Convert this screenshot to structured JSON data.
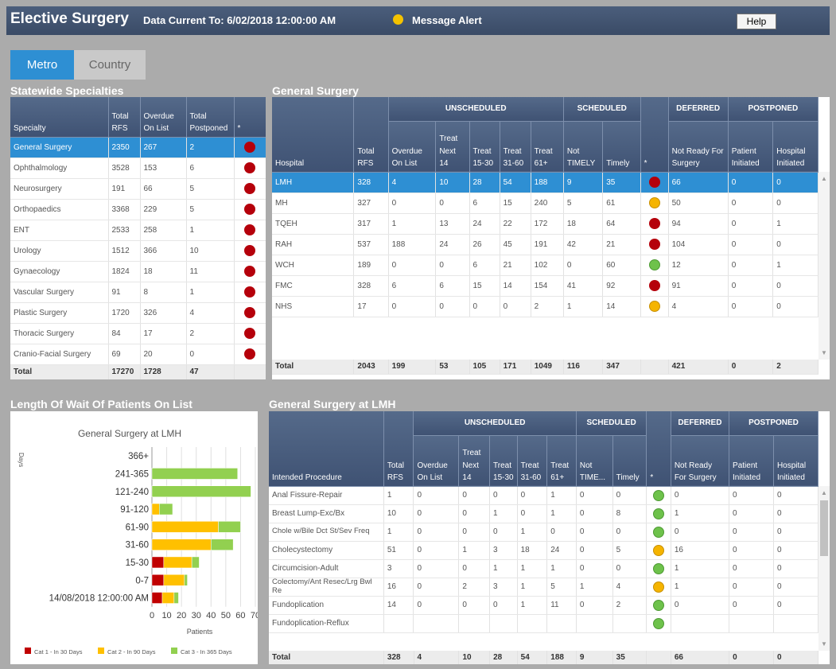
{
  "header": {
    "title": "Elective Surgery",
    "data_current": "Data Current To: 6/02/2018 12:00:00 AM",
    "message_alert": "Message Alert",
    "help": "Help"
  },
  "tabs": [
    {
      "label": "Metro",
      "active": true
    },
    {
      "label": "Country",
      "active": false
    }
  ],
  "statewide": {
    "title": "Statewide Specialties",
    "headers": [
      "Specialty",
      "Total RFS",
      "Overdue On List",
      "Total Postponed",
      "*"
    ],
    "rows": [
      {
        "specialty": "General Surgery",
        "rfs": "2350",
        "overdue": "267",
        "postponed": "2",
        "status": "red",
        "selected": true
      },
      {
        "specialty": "Ophthalmology",
        "rfs": "3528",
        "overdue": "153",
        "postponed": "6",
        "status": "red"
      },
      {
        "specialty": "Neurosurgery",
        "rfs": "191",
        "overdue": "66",
        "postponed": "5",
        "status": "red"
      },
      {
        "specialty": "Orthopaedics",
        "rfs": "3368",
        "overdue": "229",
        "postponed": "5",
        "status": "red"
      },
      {
        "specialty": "ENT",
        "rfs": "2533",
        "overdue": "258",
        "postponed": "1",
        "status": "red"
      },
      {
        "specialty": "Urology",
        "rfs": "1512",
        "overdue": "366",
        "postponed": "10",
        "status": "red"
      },
      {
        "specialty": "Gynaecology",
        "rfs": "1824",
        "overdue": "18",
        "postponed": "11",
        "status": "red"
      },
      {
        "specialty": "Vascular Surgery",
        "rfs": "91",
        "overdue": "8",
        "postponed": "1",
        "status": "red"
      },
      {
        "specialty": "Plastic Surgery",
        "rfs": "1720",
        "overdue": "326",
        "postponed": "4",
        "status": "red"
      },
      {
        "specialty": "Thoracic Surgery",
        "rfs": "84",
        "overdue": "17",
        "postponed": "2",
        "status": "red"
      },
      {
        "specialty": "Cranio-Facial Surgery",
        "rfs": "69",
        "overdue": "20",
        "postponed": "0",
        "status": "red"
      }
    ],
    "total": {
      "label": "Total",
      "rfs": "17270",
      "overdue": "1728",
      "postponed": "47"
    }
  },
  "general_surgery": {
    "title": "General Surgery",
    "groups": [
      "UNSCHEDULED",
      "SCHEDULED",
      "DEFERRED",
      "POSTPONED"
    ],
    "headers": [
      "Hospital",
      "Total RFS",
      "Overdue On List",
      "Treat Next 14",
      "Treat 15-30",
      "Treat 31-60",
      "Treat 61+",
      "Not TIMELY",
      "Timely",
      "*",
      "Not Ready For Surgery",
      "Patient Initiated",
      "Hospital Initiated"
    ],
    "rows": [
      {
        "cells": [
          "LMH",
          "328",
          "4",
          "10",
          "28",
          "54",
          "188",
          "9",
          "35"
        ],
        "status": "red",
        "tail": [
          "66",
          "0",
          "0"
        ],
        "selected": true
      },
      {
        "cells": [
          "MH",
          "327",
          "0",
          "0",
          "6",
          "15",
          "240",
          "5",
          "61"
        ],
        "status": "amber",
        "tail": [
          "50",
          "0",
          "0"
        ]
      },
      {
        "cells": [
          "TQEH",
          "317",
          "1",
          "13",
          "24",
          "22",
          "172",
          "18",
          "64"
        ],
        "status": "red",
        "tail": [
          "94",
          "0",
          "1"
        ]
      },
      {
        "cells": [
          "RAH",
          "537",
          "188",
          "24",
          "26",
          "45",
          "191",
          "42",
          "21"
        ],
        "status": "red",
        "tail": [
          "104",
          "0",
          "0"
        ]
      },
      {
        "cells": [
          "WCH",
          "189",
          "0",
          "0",
          "6",
          "21",
          "102",
          "0",
          "60"
        ],
        "status": "green",
        "tail": [
          "12",
          "0",
          "1"
        ]
      },
      {
        "cells": [
          "FMC",
          "328",
          "6",
          "6",
          "15",
          "14",
          "154",
          "41",
          "92"
        ],
        "status": "red",
        "tail": [
          "91",
          "0",
          "0"
        ]
      },
      {
        "cells": [
          "NHS",
          "17",
          "0",
          "0",
          "0",
          "0",
          "2",
          "1",
          "14"
        ],
        "status": "amber",
        "tail": [
          "4",
          "0",
          "0"
        ]
      }
    ],
    "total": [
      "Total",
      "2043",
      "199",
      "53",
      "105",
      "171",
      "1049",
      "116",
      "347",
      "",
      "421",
      "0",
      "2"
    ]
  },
  "wait_chart_title": "Length Of Wait Of Patients On List",
  "chart_data": {
    "type": "bar",
    "orientation": "horizontal",
    "stacked": true,
    "title": "General Surgery at LMH",
    "xlabel": "Patients",
    "ylabel": "Days",
    "categories": [
      "366+",
      "241-365",
      "121-240",
      "91-120",
      "61-90",
      "31-60",
      "15-30",
      "0-7",
      "14/08/2018 12:00:00 AM"
    ],
    "series": [
      {
        "name": "Cat 1 - In 30 Days",
        "color": "#c00000",
        "values": [
          0,
          0,
          0,
          0,
          0,
          0,
          8,
          8,
          7
        ]
      },
      {
        "name": "Cat 2 - In 90 Days",
        "color": "#ffc000",
        "values": [
          0,
          0,
          0,
          5,
          45,
          40,
          19,
          14,
          8
        ]
      },
      {
        "name": "Cat 3 - In 365 Days",
        "color": "#92d050",
        "values": [
          0,
          58,
          67,
          9,
          15,
          15,
          5,
          2,
          3
        ]
      }
    ],
    "xticks": [
      "0",
      "10",
      "20",
      "30",
      "40",
      "50",
      "60",
      "70"
    ],
    "xlim": [
      0,
      70
    ],
    "grid": true,
    "legend": "bottom"
  },
  "procedures": {
    "title": "General Surgery at LMH",
    "groups": [
      "UNSCHEDULED",
      "SCHEDULED",
      "DEFERRED",
      "POSTPONED"
    ],
    "headers": [
      "Intended Procedure",
      "Total RFS",
      "Overdue On List",
      "Treat Next 14",
      "Treat 15-30",
      "Treat 31-60",
      "Treat 61+",
      "Not TIME...",
      "Timely",
      "*",
      "Not Ready For Surgery",
      "Patient Initiated",
      "Hospital Initiated"
    ],
    "rows": [
      {
        "cells": [
          "Anal Fissure-Repair",
          "1",
          "0",
          "0",
          "0",
          "0",
          "1",
          "0",
          "0"
        ],
        "status": "green",
        "tail": [
          "0",
          "0",
          "0"
        ]
      },
      {
        "cells": [
          "Breast Lump-Exc/Bx",
          "10",
          "0",
          "0",
          "1",
          "0",
          "1",
          "0",
          "8"
        ],
        "status": "green",
        "tail": [
          "1",
          "0",
          "0"
        ]
      },
      {
        "cells": [
          "Chole w/Bile Dct St/Sev Freq",
          "1",
          "0",
          "0",
          "0",
          "1",
          "0",
          "0",
          "0"
        ],
        "status": "green",
        "tail": [
          "0",
          "0",
          "0"
        ]
      },
      {
        "cells": [
          "Cholecystectomy",
          "51",
          "0",
          "1",
          "3",
          "18",
          "24",
          "0",
          "5"
        ],
        "status": "amber",
        "tail": [
          "16",
          "0",
          "0"
        ]
      },
      {
        "cells": [
          "Circumcision-Adult",
          "3",
          "0",
          "0",
          "1",
          "1",
          "1",
          "0",
          "0"
        ],
        "status": "green",
        "tail": [
          "1",
          "0",
          "0"
        ]
      },
      {
        "cells": [
          "Colectomy/Ant Resec/Lrg Bwl Re",
          "16",
          "0",
          "2",
          "3",
          "1",
          "5",
          "1",
          "4"
        ],
        "status": "amber",
        "tail": [
          "1",
          "0",
          "0"
        ]
      },
      {
        "cells": [
          "Fundoplication",
          "14",
          "0",
          "0",
          "0",
          "1",
          "11",
          "0",
          "2"
        ],
        "status": "green",
        "tail": [
          "0",
          "0",
          "0"
        ]
      },
      {
        "cells": [
          "Fundoplication-Reflux",
          "",
          "",
          "",
          "",
          "",
          "",
          "",
          ""
        ],
        "status": "green",
        "tail": [
          "",
          "",
          ""
        ]
      }
    ],
    "total": [
      "Total",
      "328",
      "4",
      "10",
      "28",
      "54",
      "188",
      "9",
      "35",
      "",
      "66",
      "0",
      "0"
    ]
  }
}
